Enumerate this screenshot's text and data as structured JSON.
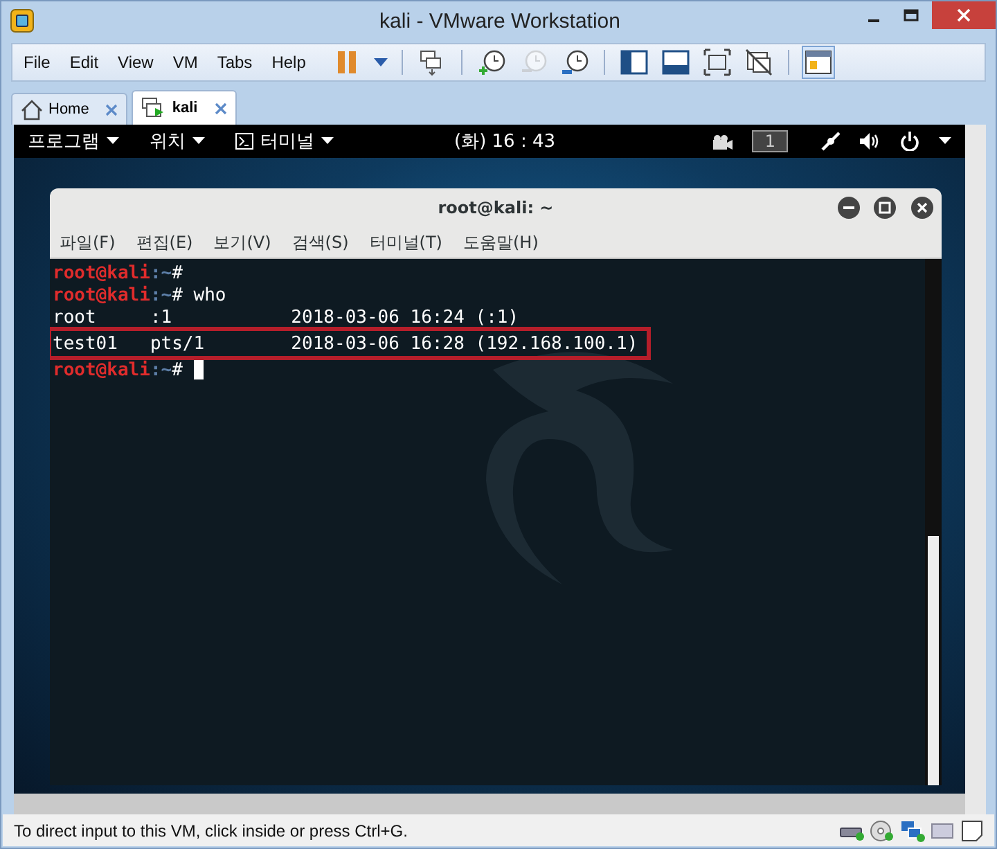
{
  "window": {
    "title": "kali - VMware Workstation"
  },
  "menu": [
    "File",
    "Edit",
    "View",
    "VM",
    "Tabs",
    "Help"
  ],
  "toolbar": [
    {
      "kind": "pause",
      "on": false,
      "disabled": false
    },
    {
      "kind": "send-keys",
      "on": false,
      "disabled": false
    },
    {
      "kind": "snapshot",
      "on": false,
      "disabled": false
    },
    {
      "kind": "revert",
      "on": false,
      "disabled": true
    },
    {
      "kind": "manage",
      "on": false,
      "disabled": false
    },
    {
      "kind": "sidebar",
      "on": false,
      "disabled": false
    },
    {
      "kind": "thumbnail",
      "on": false,
      "disabled": false
    },
    {
      "kind": "fullscreen",
      "on": false,
      "disabled": false
    },
    {
      "kind": "unity",
      "on": false,
      "disabled": false
    },
    {
      "kind": "console",
      "on": true,
      "disabled": false
    }
  ],
  "tabs": [
    {
      "label": "Home",
      "selected": false
    },
    {
      "label": "kali",
      "selected": true
    }
  ],
  "guest_panel": {
    "applications": "프로그램",
    "places": "위치",
    "terminal": "터미널",
    "clock": "(화) 16 : 43",
    "workspace": "1"
  },
  "terminal": {
    "title": "root@kali: ~",
    "menu": [
      "파일(F)",
      "편집(E)",
      "보기(V)",
      "검색(S)",
      "터미널(T)",
      "도움말(H)"
    ],
    "lines": [
      {
        "highlighted": false,
        "cursor": false,
        "segments": [
          {
            "kind": "user",
            "text": "root@kali"
          },
          {
            "kind": "path",
            "text": ":~"
          },
          {
            "kind": "plain",
            "text": "# "
          }
        ]
      },
      {
        "highlighted": false,
        "cursor": false,
        "segments": [
          {
            "kind": "user",
            "text": "root@kali"
          },
          {
            "kind": "path",
            "text": ":~"
          },
          {
            "kind": "plain",
            "text": "# who"
          }
        ]
      },
      {
        "highlighted": false,
        "cursor": false,
        "segments": [
          {
            "kind": "plain",
            "text": "root     :1           2018-03-06 16:24 (:1)"
          }
        ]
      },
      {
        "highlighted": true,
        "cursor": false,
        "segments": [
          {
            "kind": "plain",
            "text": "test01   pts/1        2018-03-06 16:28 (192.168.100.1)"
          }
        ]
      },
      {
        "highlighted": false,
        "cursor": true,
        "segments": [
          {
            "kind": "user",
            "text": "root@kali"
          },
          {
            "kind": "path",
            "text": ":~"
          },
          {
            "kind": "plain",
            "text": "# "
          }
        ]
      }
    ]
  },
  "status_bar": {
    "text": "To direct input to this VM, click inside or press Ctrl+G."
  }
}
